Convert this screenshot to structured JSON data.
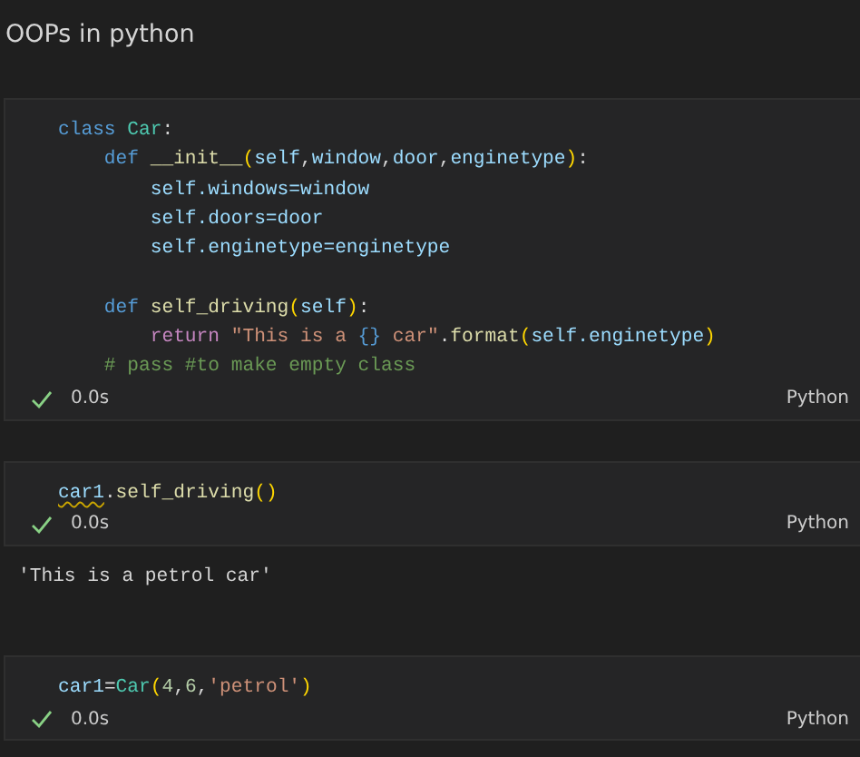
{
  "heading": "OOPs in python",
  "cells": [
    {
      "lines": [
        {
          "tokens": [
            {
              "kind": "keyword",
              "text": "class "
            },
            {
              "kind": "class",
              "text": "Car"
            },
            {
              "kind": "plain",
              "text": ":"
            }
          ]
        },
        {
          "tokens": [
            {
              "kind": "keyword",
              "text": "    def "
            },
            {
              "kind": "func",
              "text": "__init__"
            },
            {
              "kind": "bracket",
              "text": "("
            },
            {
              "kind": "var",
              "text": "self"
            },
            {
              "kind": "plain",
              "text": ","
            },
            {
              "kind": "var",
              "text": "window"
            },
            {
              "kind": "plain",
              "text": ","
            },
            {
              "kind": "var",
              "text": "door"
            },
            {
              "kind": "plain",
              "text": ","
            },
            {
              "kind": "var",
              "text": "enginetype"
            },
            {
              "kind": "bracket",
              "text": ")"
            },
            {
              "kind": "plain",
              "text": ":"
            }
          ]
        },
        {
          "tokens": [
            {
              "kind": "var",
              "text": "        self.windows=window"
            }
          ]
        },
        {
          "tokens": [
            {
              "kind": "var",
              "text": "        self.doors=door"
            }
          ]
        },
        {
          "tokens": [
            {
              "kind": "var",
              "text": "        self.enginetype=enginetype"
            }
          ]
        },
        {
          "spaced": true,
          "tokens": [
            {
              "kind": "keyword",
              "text": "    def "
            },
            {
              "kind": "func",
              "text": "self_driving"
            },
            {
              "kind": "bracket",
              "text": "("
            },
            {
              "kind": "var",
              "text": "self"
            },
            {
              "kind": "bracket",
              "text": ")"
            },
            {
              "kind": "plain",
              "text": ":"
            }
          ]
        },
        {
          "tokens": [
            {
              "kind": "control",
              "text": "        return "
            },
            {
              "kind": "string",
              "text": "\"This is a "
            },
            {
              "kind": "keyword",
              "text": "{}"
            },
            {
              "kind": "string",
              "text": " car\""
            },
            {
              "kind": "plain",
              "text": "."
            },
            {
              "kind": "func",
              "text": "format"
            },
            {
              "kind": "bracket",
              "text": "("
            },
            {
              "kind": "var",
              "text": "self.enginetype"
            },
            {
              "kind": "bracket",
              "text": ")"
            }
          ]
        },
        {
          "tokens": [
            {
              "kind": "comment",
              "text": "    # pass #to make empty class"
            }
          ]
        }
      ],
      "status": {
        "ok": true,
        "time": "0.0s",
        "language": "Python"
      }
    },
    {
      "lines": [
        {
          "tokens": [
            {
              "kind": "var",
              "text": "car1",
              "warning": true
            },
            {
              "kind": "plain",
              "text": "."
            },
            {
              "kind": "func",
              "text": "self_driving"
            },
            {
              "kind": "bracket",
              "text": "()"
            }
          ]
        }
      ],
      "status": {
        "ok": true,
        "time": "0.0s",
        "language": "Python"
      },
      "output": "'This is a petrol car'"
    },
    {
      "lines": [
        {
          "tokens": [
            {
              "kind": "var",
              "text": "car1"
            },
            {
              "kind": "plain",
              "text": "="
            },
            {
              "kind": "class",
              "text": "Car"
            },
            {
              "kind": "bracket",
              "text": "("
            },
            {
              "kind": "number",
              "text": "4"
            },
            {
              "kind": "plain",
              "text": ","
            },
            {
              "kind": "number",
              "text": "6"
            },
            {
              "kind": "plain",
              "text": ","
            },
            {
              "kind": "string",
              "text": "'petrol'"
            },
            {
              "kind": "bracket",
              "text": ")"
            }
          ]
        }
      ],
      "status": {
        "ok": true,
        "time": "0.0s",
        "language": "Python"
      }
    }
  ]
}
